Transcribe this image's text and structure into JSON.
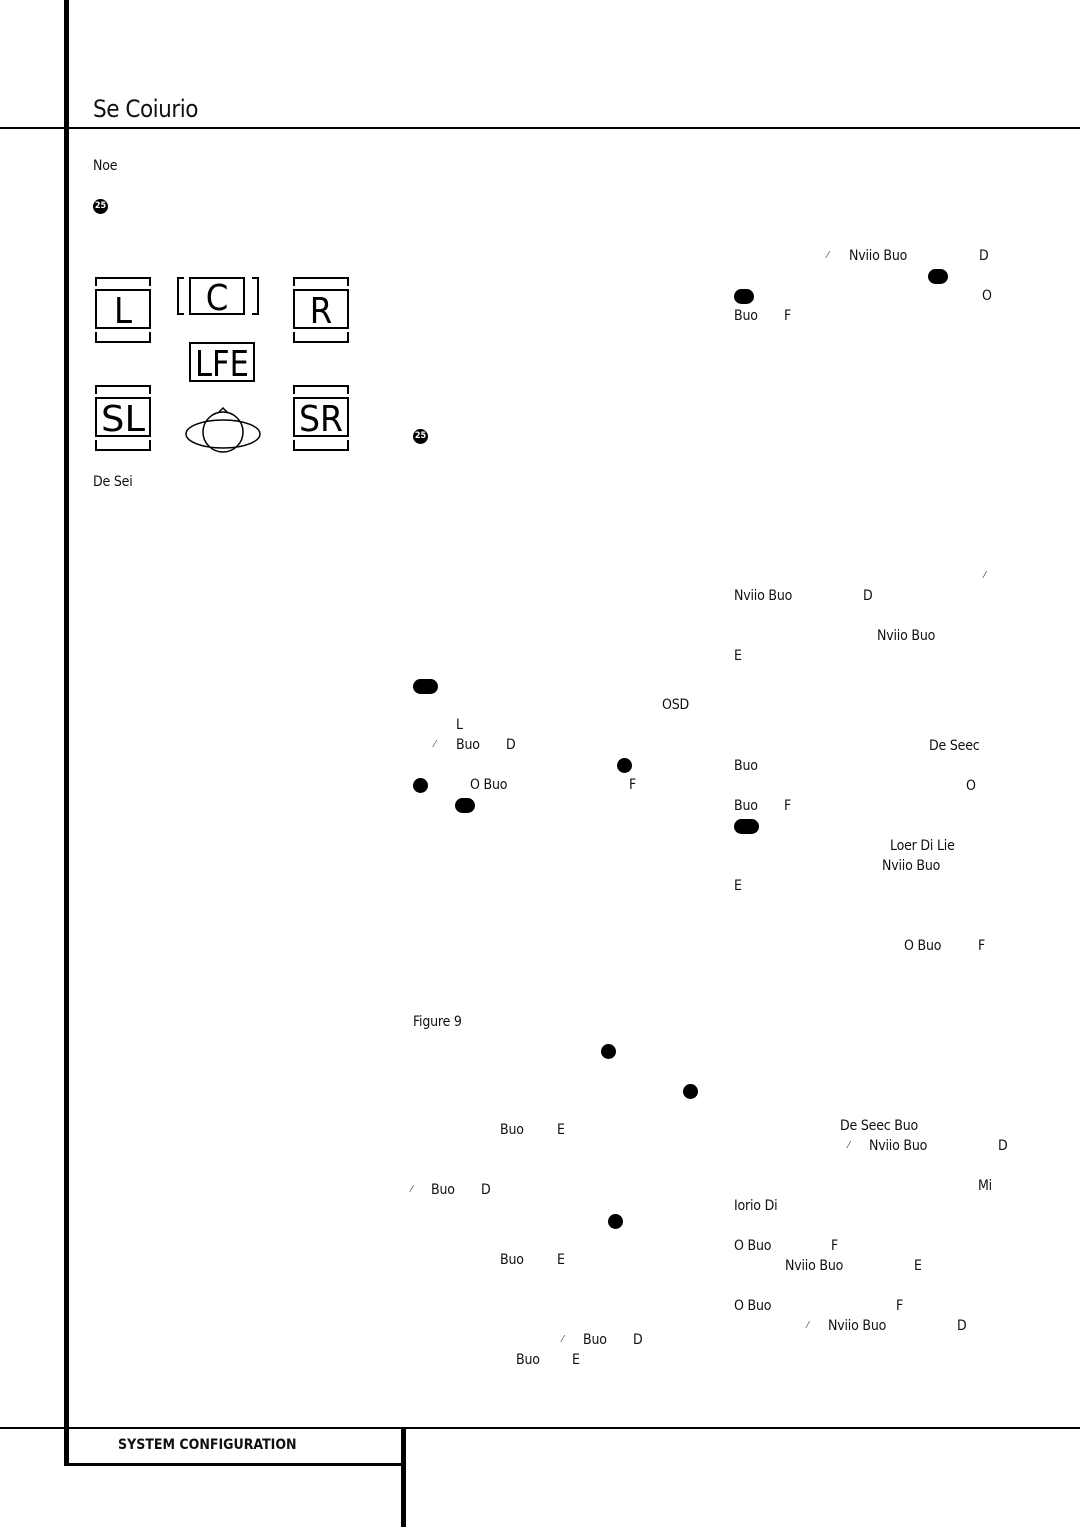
{
  "header": {
    "title": "Se Coiurio"
  },
  "footer": {
    "section_label": "SYSTEM CONFIGURATION"
  },
  "left_column": {
    "note_label": "Noe",
    "badge_25": "25",
    "diagram": {
      "speakers": [
        "L",
        "C",
        "R",
        "LFE",
        "SL",
        "SR"
      ],
      "listener_icon": "listener-head-icon"
    },
    "diagram_caption": "De Sei"
  },
  "middle_column": {
    "badge_25": "25",
    "badge_a": "",
    "osd": "OSD",
    "l_label": "L",
    "slash1": "⁄",
    "buo1": "Buo",
    "d1": "D",
    "badge_b": "",
    "badge_c": "",
    "o_buo": "O Buo",
    "f1": "F",
    "badge_d": "",
    "figure_label": "Figure 9",
    "badge_e": "",
    "badge_f": "",
    "buo2": "Buo",
    "e1": "E",
    "slash2": "⁄",
    "buo3": "Buo",
    "d2": "D",
    "badge_g": "",
    "buo4": "Buo",
    "e2": "E",
    "slash3": "⁄",
    "buo5": "Buo",
    "d3": "D",
    "buo6": "Buo",
    "e3": "E"
  },
  "right_column": {
    "slash1": "⁄",
    "nav1": "Nviio Buo",
    "d1": "D",
    "badge_a": "",
    "badge_b": "",
    "o1": "O",
    "buo1": "Buo",
    "f1": "F",
    "slash2": "⁄",
    "nav2": "Nviio Buo",
    "d2": "D",
    "nav3": "Nviio Buo",
    "e1": "E",
    "de_seec": "De Seec",
    "buo2": "Buo",
    "o2": "O",
    "buo3": "Buo",
    "f2": "F",
    "badge_c": "",
    "loer": "Loer Di Lie",
    "nav4": "Nviio Buo",
    "e2": "E",
    "o_buo1": "O Buo",
    "f3": "F",
    "de_seec_buo": "De Seec Buo",
    "slash3": "⁄",
    "nav5": "Nviio Buo",
    "d3": "D",
    "mi": "Mi",
    "iorio": "Iorio Di",
    "o_buo2": "O Buo",
    "f4": "F",
    "nav6": "Nviio Buo",
    "e3": "E",
    "o_buo3": "O Buo",
    "f5": "F",
    "slash4": "⁄",
    "nav7": "Nviio Buo",
    "d4": "D"
  }
}
